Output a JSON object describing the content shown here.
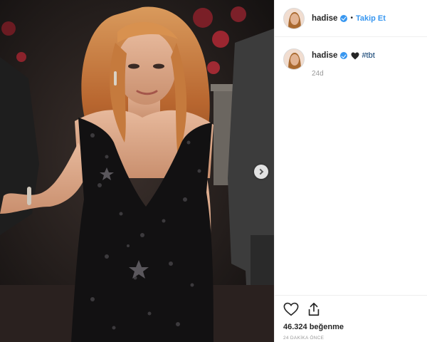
{
  "header": {
    "username": "hadise",
    "separator": "•",
    "follow_label": "Takip Et"
  },
  "caption": {
    "username": "hadise",
    "emoji_icon": "black-heart-icon",
    "hashtag": "#tbt",
    "age": "24d"
  },
  "actions": {
    "like_icon": "heart-outline-icon",
    "share_icon": "share-icon"
  },
  "likes": {
    "text": "46.324 beğenme"
  },
  "timestamp": {
    "text": "24 DAKİKA ÖNCE"
  },
  "carousel": {
    "next_icon": "chevron-right-icon"
  },
  "colors": {
    "accent": "#3897f0",
    "text": "#262626",
    "muted": "#999999",
    "hashtag": "#003569"
  }
}
